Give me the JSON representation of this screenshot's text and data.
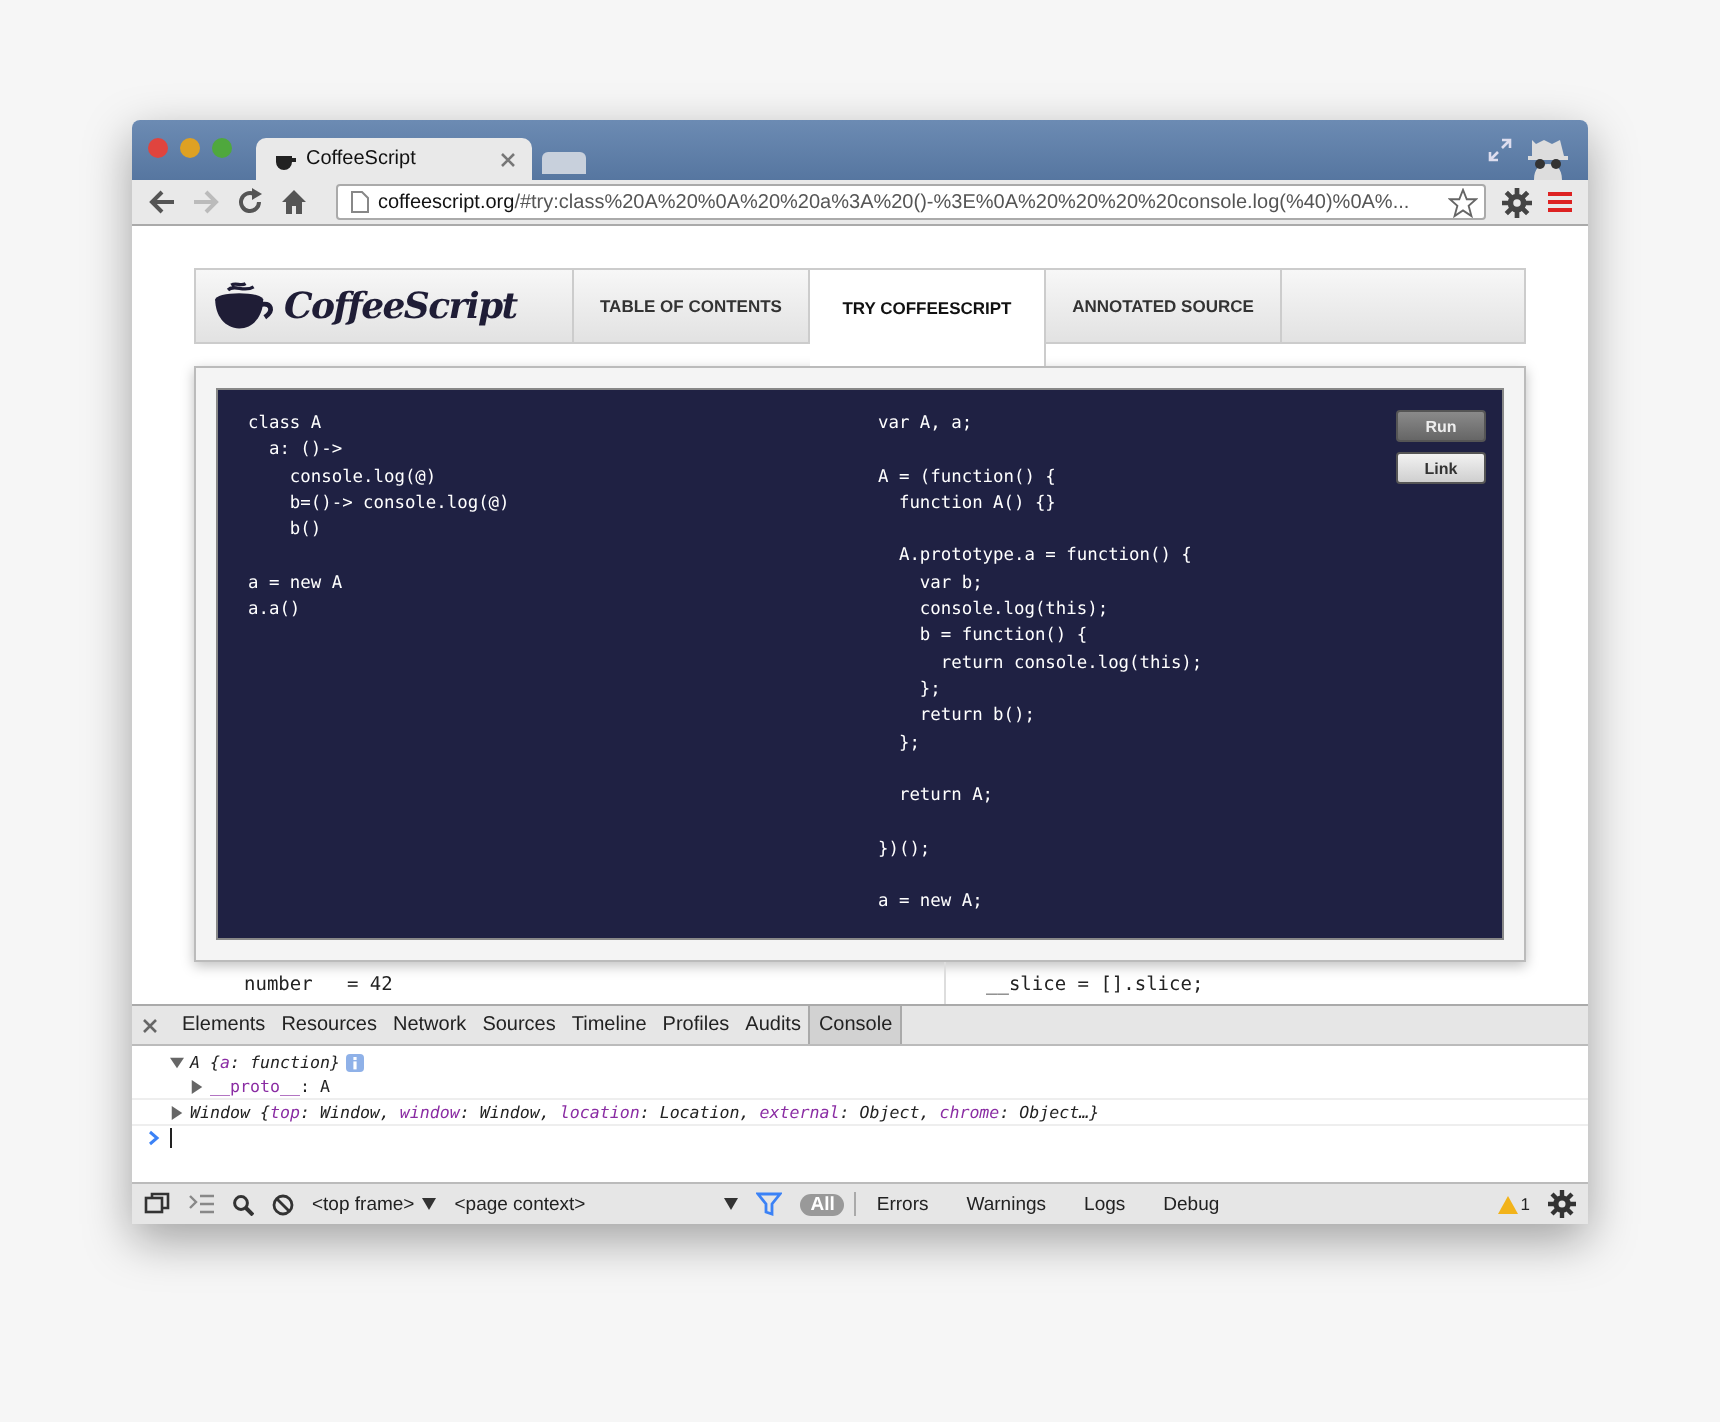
{
  "browser": {
    "tabs": [
      {
        "title": "CoffeeScript",
        "selected": true
      }
    ],
    "url_host": "coffeescript.org",
    "url_rest": "/#try:class%20A%20%0A%20%20a%3A%20()-%3E%0A%20%20%20%20console.log(%40)%0A%..."
  },
  "site": {
    "logo": "CoffeeScript",
    "nav": [
      {
        "label": "TABLE OF CONTENTS",
        "selected": false
      },
      {
        "label": "TRY COFFEESCRIPT",
        "selected": true
      },
      {
        "label": "ANNOTATED SOURCE",
        "selected": false
      }
    ]
  },
  "try": {
    "coffee_code": "class A\n  a: ()->\n    console.log(@)\n    b=()-> console.log(@)\n    b()\n\na = new A\na.a()",
    "javascript_code": "var A, a;\n\nA = (function() {\n  function A() {}\n\n  A.prototype.a = function() {\n    var b;\n    console.log(this);\n    b = function() {\n      return console.log(this);\n    };\n    return b();\n  };\n\n  return A;\n\n})();\n\na = new A;",
    "buttons": [
      {
        "label": "Run",
        "kind": "primary"
      },
      {
        "label": "Link",
        "kind": "secondary"
      }
    ]
  },
  "page_behind": {
    "left": "number   = 42",
    "right": "__slice = [].slice;"
  },
  "devtools": {
    "panels": [
      {
        "label": "Elements",
        "selected": false
      },
      {
        "label": "Resources",
        "selected": false
      },
      {
        "label": "Network",
        "selected": false
      },
      {
        "label": "Sources",
        "selected": false
      },
      {
        "label": "Timeline",
        "selected": false
      },
      {
        "label": "Profiles",
        "selected": false
      },
      {
        "label": "Audits",
        "selected": false
      },
      {
        "label": "Console",
        "selected": true
      }
    ],
    "console": [
      {
        "expanded": true,
        "info": true,
        "parts": [
          {
            "text": "A {",
            "kind": "plain"
          },
          {
            "text": "a",
            "kind": "key"
          },
          {
            "text": ": function}",
            "kind": "plain"
          }
        ],
        "children": [
          {
            "expanded": false,
            "parts": [
              {
                "text": "__proto__",
                "kind": "key"
              },
              {
                "text": ": A",
                "kind": "plain"
              }
            ]
          }
        ]
      },
      {
        "expanded": false,
        "info": false,
        "parts": [
          {
            "text": "Window {",
            "kind": "plain"
          },
          {
            "text": "top",
            "kind": "key"
          },
          {
            "text": ": Window, ",
            "kind": "plain"
          },
          {
            "text": "window",
            "kind": "key"
          },
          {
            "text": ": Window, ",
            "kind": "plain"
          },
          {
            "text": "location",
            "kind": "key"
          },
          {
            "text": ": Location, ",
            "kind": "plain"
          },
          {
            "text": "external",
            "kind": "key"
          },
          {
            "text": ": Object, ",
            "kind": "plain"
          },
          {
            "text": "chrome",
            "kind": "key"
          },
          {
            "text": ": Object…}",
            "kind": "plain"
          }
        ]
      }
    ],
    "frame": "<top frame>",
    "context": "<page context>",
    "filter_on": true,
    "levels": [
      {
        "label": "All",
        "selected": true
      },
      {
        "label": "Errors",
        "selected": false
      },
      {
        "label": "Warnings",
        "selected": false
      },
      {
        "label": "Logs",
        "selected": false
      },
      {
        "label": "Debug",
        "selected": false
      }
    ],
    "warnings": "1"
  }
}
